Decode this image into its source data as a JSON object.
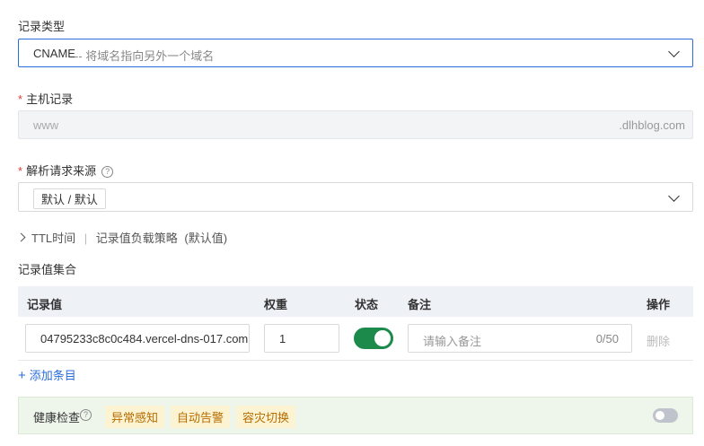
{
  "record_type": {
    "label": "记录类型",
    "value_main": "CNAME",
    "value_desc": " -- 将域名指向另外一个域名"
  },
  "host_record": {
    "label": "主机记录",
    "required_mark": "*",
    "placeholder": "www",
    "suffix": ".dlhblog.com"
  },
  "resolve_source": {
    "label": "解析请求来源",
    "required_mark": "*",
    "help_glyph": "?",
    "tag": "默认 / 默认"
  },
  "advanced": {
    "ttl": "TTL时间",
    "separator": "|",
    "strategy": "记录值负载策略",
    "default_hint": "(默认值)"
  },
  "record_set": {
    "title": "记录值集合",
    "columns": {
      "value": "记录值",
      "weight": "权重",
      "status": "状态",
      "note": "备注",
      "action": "操作"
    },
    "rows": [
      {
        "value": "04795233c8c0c484.vercel-dns-017.com",
        "weight": "1",
        "status_on": true,
        "note_placeholder": "请输入备注",
        "note_count": "0/50",
        "delete": "删除"
      }
    ],
    "add_entry": "添加条目",
    "add_glyph": "+"
  },
  "health_check": {
    "label": "健康检查",
    "help_glyph": "?",
    "chips": [
      "异常感知",
      "自动告警",
      "容灾切换"
    ],
    "enabled": false
  },
  "colors": {
    "accent": "#2a6edb",
    "toggle_on": "#1b8a4a",
    "health_bg": "#eef6ec",
    "chip_bg": "#fbf3d2",
    "chip_text": "#b86c00",
    "required": "#e03d3d"
  }
}
